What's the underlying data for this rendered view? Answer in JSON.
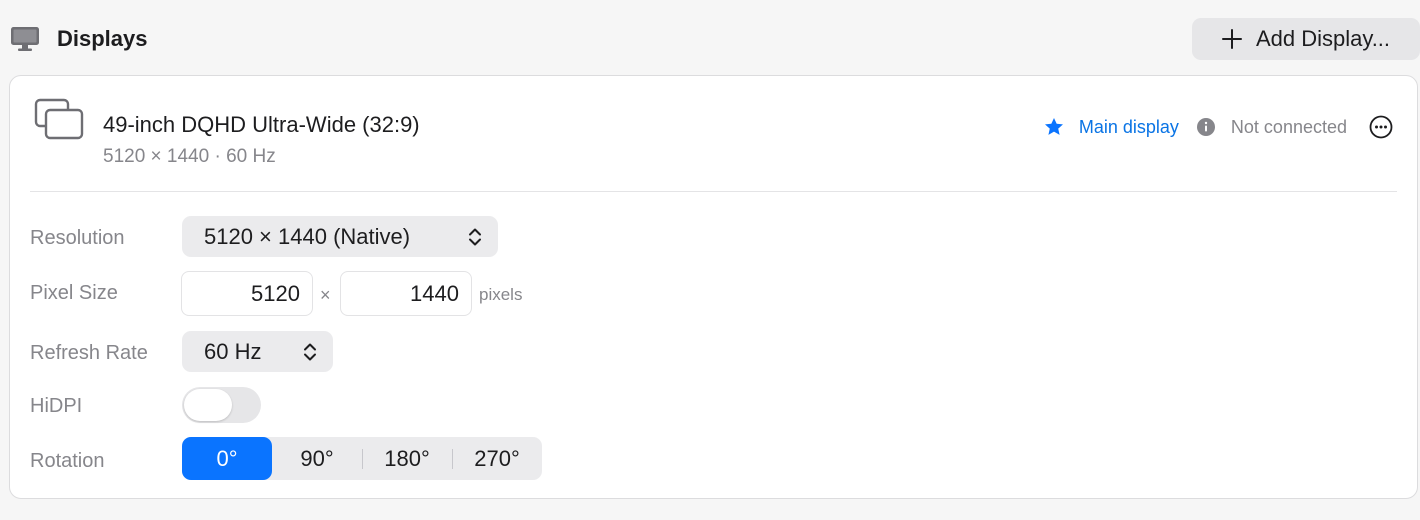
{
  "section": {
    "title": "Displays",
    "icon": "monitor-icon",
    "add_button_label": "Add Display..."
  },
  "display": {
    "name": "49-inch DQHD Ultra-Wide (32:9)",
    "spec": "5120 × 1440 · 60 Hz",
    "main_display_label": "Main display",
    "status": "Not connected",
    "accent_color": "#0a74ff"
  },
  "settings": {
    "resolution_label": "Resolution",
    "resolution_value": "5120 × 1440 (Native)",
    "pixel_size_label": "Pixel Size",
    "pixel_width": "5120",
    "pixel_separator": "×",
    "pixel_height": "1440",
    "pixel_unit": "pixels",
    "refresh_label": "Refresh Rate",
    "refresh_value": "60 Hz",
    "hidpi_label": "HiDPI",
    "hidpi_enabled": false,
    "rotation_label": "Rotation",
    "rotation_options": [
      "0°",
      "90°",
      "180°",
      "270°"
    ],
    "rotation_selected": "0°"
  }
}
